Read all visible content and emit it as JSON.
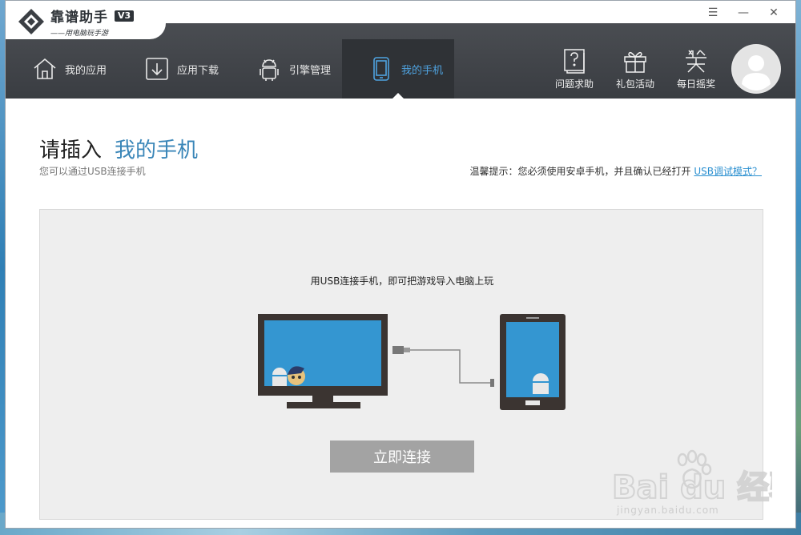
{
  "app": {
    "name": "靠谱助手",
    "version": "V3",
    "slogan": "——用电脑玩手游"
  },
  "window_controls": {
    "menu": "☰",
    "minimize": "—",
    "close": "✕"
  },
  "nav": {
    "tabs": [
      {
        "label": "我的应用",
        "icon": "home-icon",
        "active": false
      },
      {
        "label": "应用下载",
        "icon": "download-icon",
        "active": false
      },
      {
        "label": "引擎管理",
        "icon": "android-icon",
        "active": false
      },
      {
        "label": "我的手机",
        "icon": "phone-icon",
        "active": true
      }
    ],
    "actions": [
      {
        "label": "问题求助",
        "icon": "help-book-icon"
      },
      {
        "label": "礼包活动",
        "icon": "gift-icon"
      },
      {
        "label": "每日摇奖",
        "icon": "lottery-icon"
      }
    ]
  },
  "content": {
    "title_prefix": "请插入",
    "title_accent": "我的手机",
    "subtitle": "您可以通过USB连接手机",
    "hint_text": "温馨提示：您必须使用安卓手机，并且确认已经打开",
    "hint_link": "USB调试模式？",
    "panel_text": "用USB连接手机，即可把游戏导入电脑上玩",
    "connect_button": "立即连接"
  },
  "watermark": {
    "text": "jingyan.baidu.com",
    "brand": "Bai du 经验"
  },
  "colors": {
    "accent": "#3a86b8",
    "nav_bg": "#3a3d42",
    "active_tab_text": "#4fa3e0",
    "button_gray": "#a3a3a3",
    "illustration_dark": "#3b3431",
    "illustration_screen": "#3496d1"
  }
}
